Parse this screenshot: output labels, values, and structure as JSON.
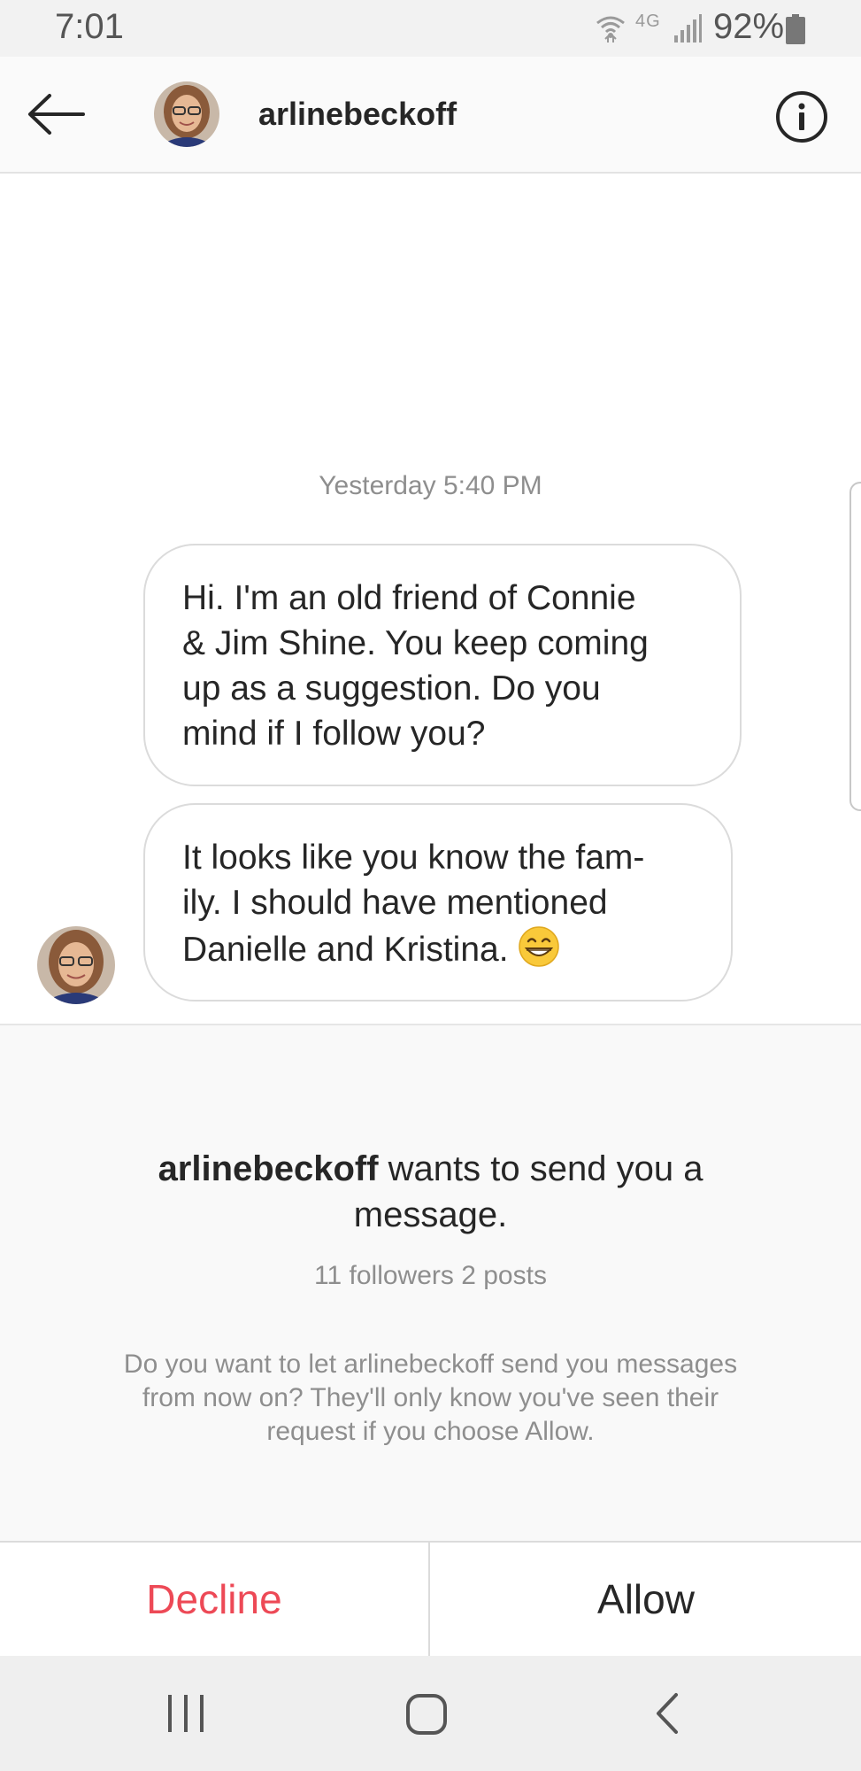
{
  "status_bar": {
    "time": "7:01",
    "network": "4G",
    "battery": "92%"
  },
  "header": {
    "username": "arlinebeckoff"
  },
  "chat": {
    "timestamp": "Yesterday 5:40 PM",
    "messages": [
      {
        "lines": [
          "Hi. I'm an old friend of Connie",
          "& Jim Shine. You keep coming",
          "up as a suggestion. Do you",
          "mind if I follow you?"
        ]
      },
      {
        "lines": [
          "It looks like you know the fam-",
          "ily. I should have mentioned",
          "Danielle and Kristina."
        ],
        "emoji": "grinning-face-with-smiling-eyes"
      }
    ]
  },
  "request": {
    "username": "arlinebeckoff",
    "title_rest": "wants to send you a",
    "title_line2": "message.",
    "stats": "11 followers 2 posts",
    "description_lines": [
      "Do you want to let arlinebeckoff send you messages",
      "from now on? They'll only know you've seen their",
      "request if you choose Allow."
    ]
  },
  "actions": {
    "decline": "Decline",
    "allow": "Allow"
  },
  "colors": {
    "decline": "#ed4956",
    "text_primary": "#262626",
    "text_secondary": "#8e8e8e",
    "bubble_border": "#dbdbdb"
  }
}
